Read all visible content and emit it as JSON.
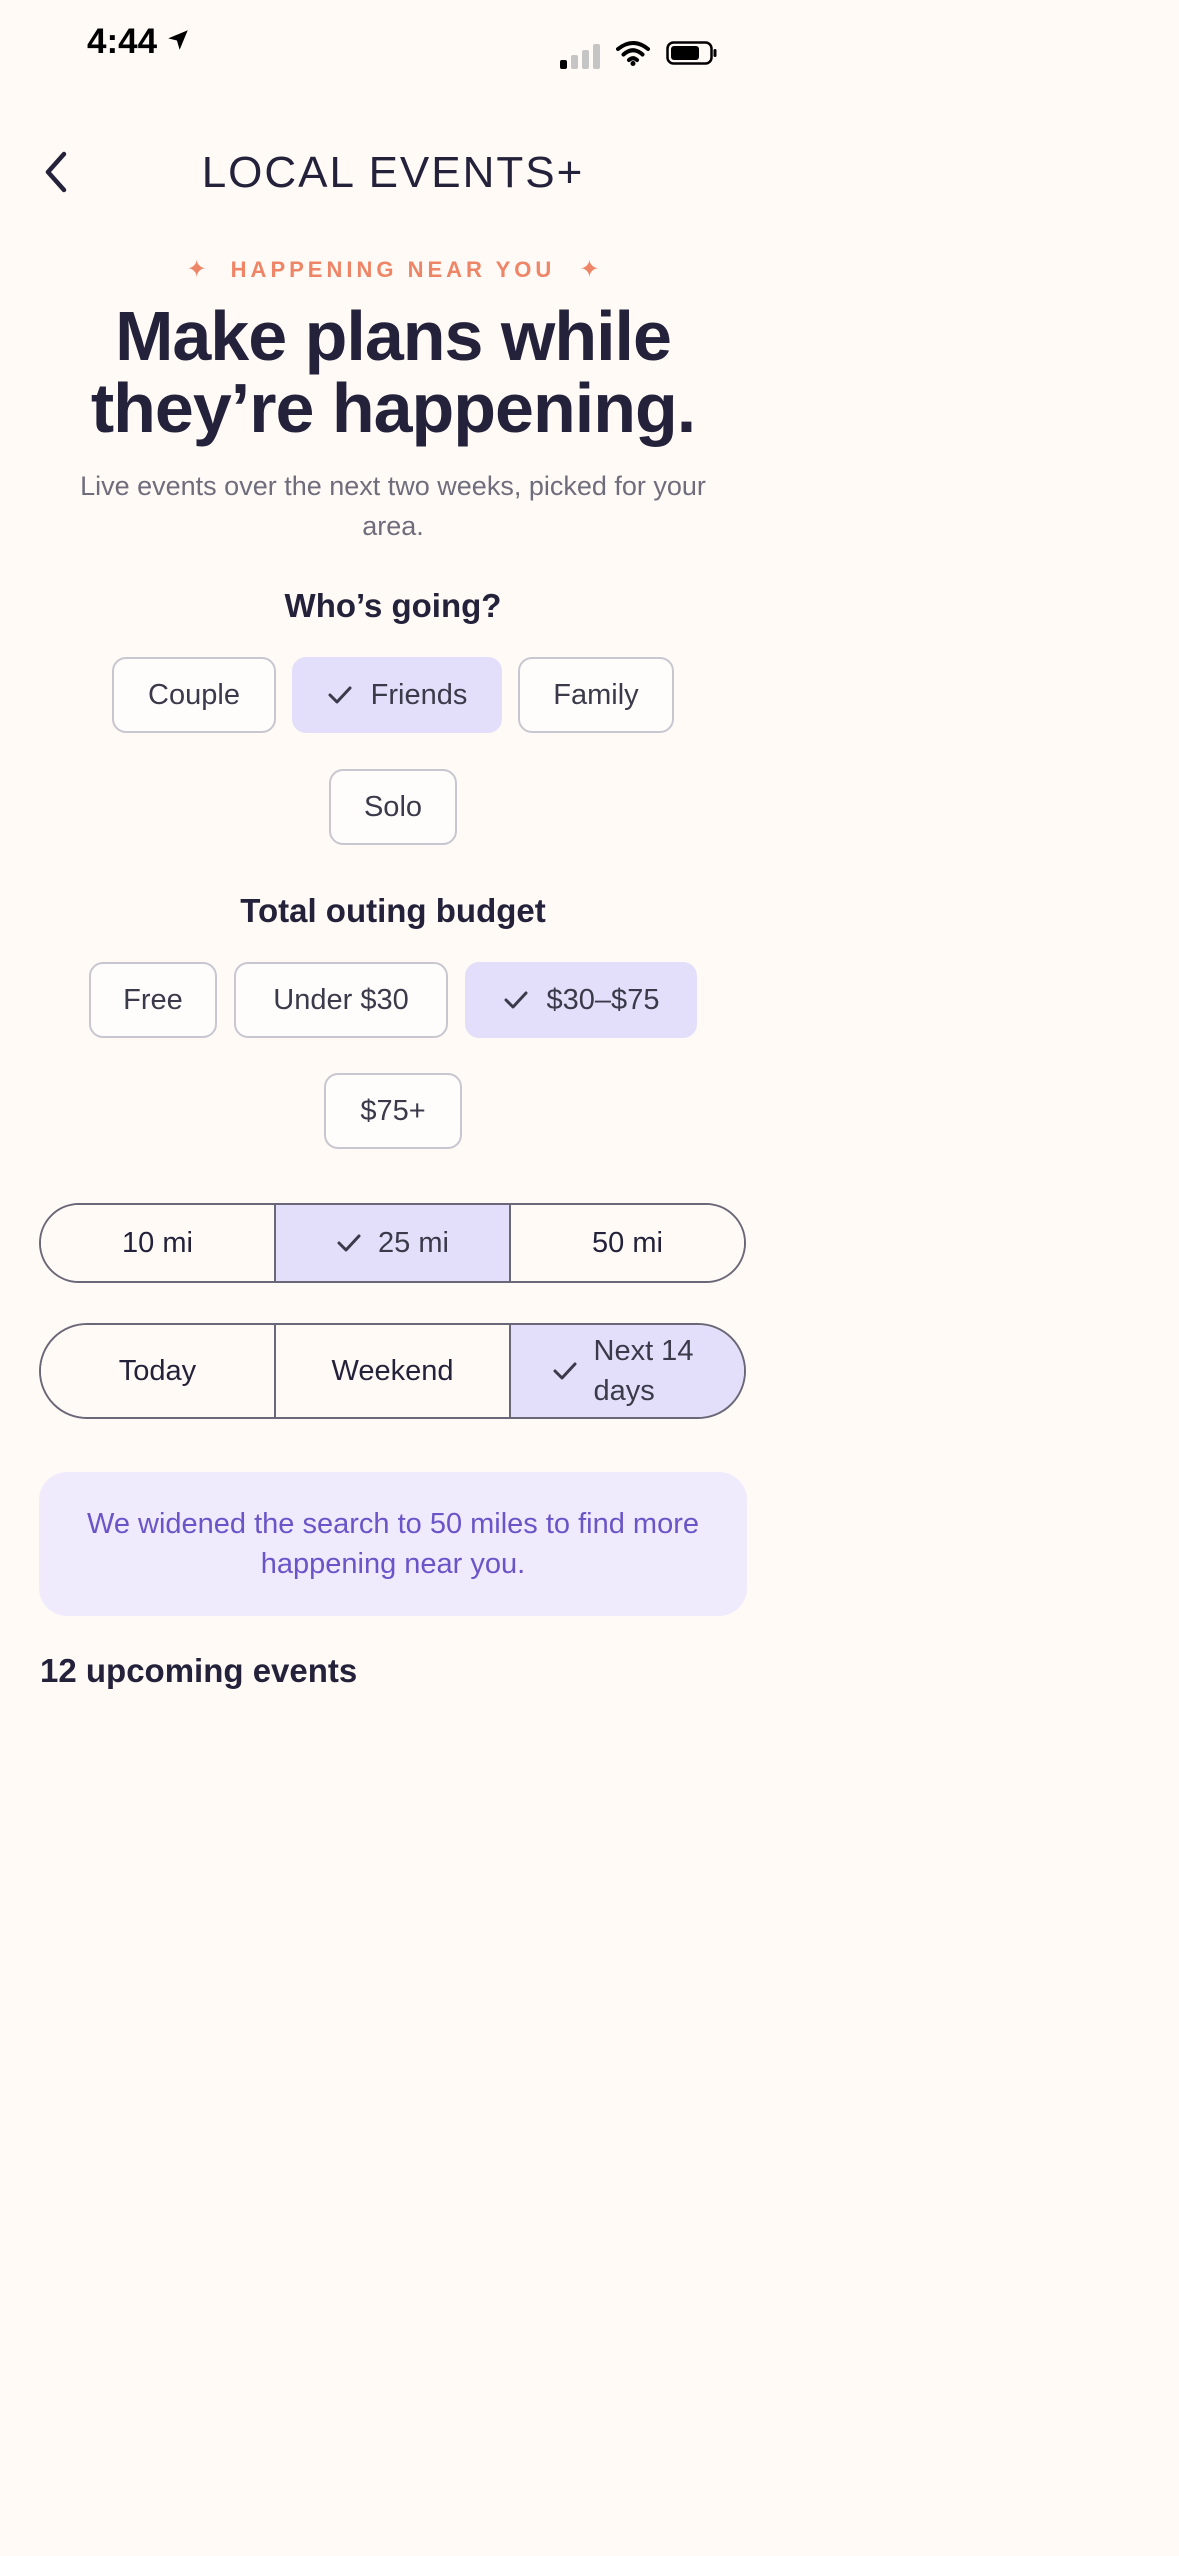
{
  "status_bar": {
    "time": "4:44"
  },
  "nav": {
    "title": "LOCAL EVENTS+"
  },
  "hero": {
    "eyebrow": "HAPPENING NEAR YOU",
    "headline_line1": "Make plans while",
    "headline_line2": "they’re happening.",
    "subtext": "Live events over the next two weeks, picked for your area."
  },
  "whos_going": {
    "title": "Who’s going?",
    "options": [
      {
        "label": "Couple",
        "selected": false
      },
      {
        "label": "Friends",
        "selected": true
      },
      {
        "label": "Family",
        "selected": false
      },
      {
        "label": "Solo",
        "selected": false
      }
    ]
  },
  "budget": {
    "title": "Total outing budget",
    "options": [
      {
        "label": "Free",
        "selected": false
      },
      {
        "label": "Under $30",
        "selected": false
      },
      {
        "label": "$30–$75",
        "selected": true
      },
      {
        "label": "$75+",
        "selected": false
      }
    ]
  },
  "distance": {
    "options": [
      {
        "label": "10 mi",
        "selected": false
      },
      {
        "label": "25 mi",
        "selected": true
      },
      {
        "label": "50 mi",
        "selected": false
      }
    ]
  },
  "timeframe": {
    "options": [
      {
        "label": "Today",
        "selected": false
      },
      {
        "label": "Weekend",
        "selected": false
      },
      {
        "label": "Next 14 days",
        "selected": true
      }
    ]
  },
  "notice": "We widened the search to 50 miles to find more happening near you.",
  "events_count": "12 upcoming events",
  "colors": {
    "background": "#fffaf6",
    "accent": "#ee8566",
    "selected_fill": "#e3dffa",
    "notice_text": "#6a55c8"
  }
}
